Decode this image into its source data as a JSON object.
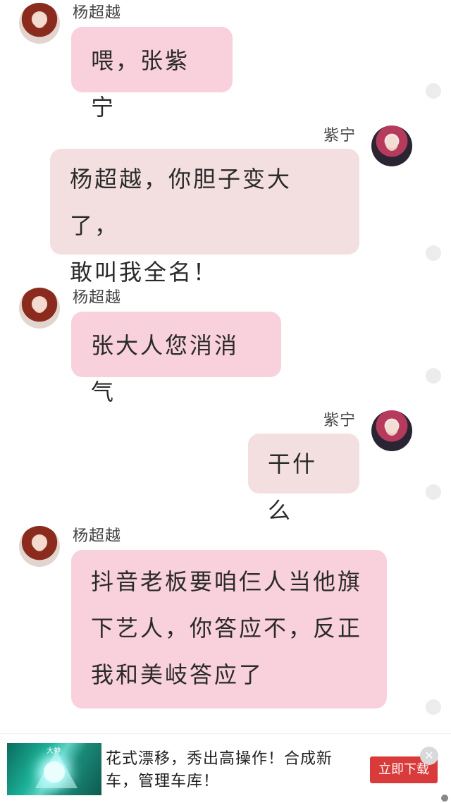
{
  "messages": [
    {
      "side": "left",
      "name": "杨超越",
      "lines": [
        "喂，张紫宁"
      ]
    },
    {
      "side": "right",
      "name": "紫宁",
      "lines": [
        "杨超越，你胆子变大了，",
        "敢叫我全名！"
      ]
    },
    {
      "side": "left",
      "name": "杨超越",
      "lines": [
        "张大人您消消气"
      ]
    },
    {
      "side": "right",
      "name": "紫宁",
      "lines": [
        "干什么"
      ]
    },
    {
      "side": "left",
      "name": "杨超越",
      "lines": [
        "抖音老板要咱仨人当他旗",
        "下艺人，你答应不，反正",
        "我和美岐答应了"
      ]
    }
  ],
  "ad": {
    "thumb_tag": "大神",
    "text": "花式漂移，秀出高操作！合成新车，管理车库！",
    "button": "立即下载",
    "close": "✕"
  },
  "colors": {
    "pink_bubble": "#f9d1dc",
    "beige_bubble": "#f3dfdf",
    "ad_button": "#d93a3a"
  }
}
